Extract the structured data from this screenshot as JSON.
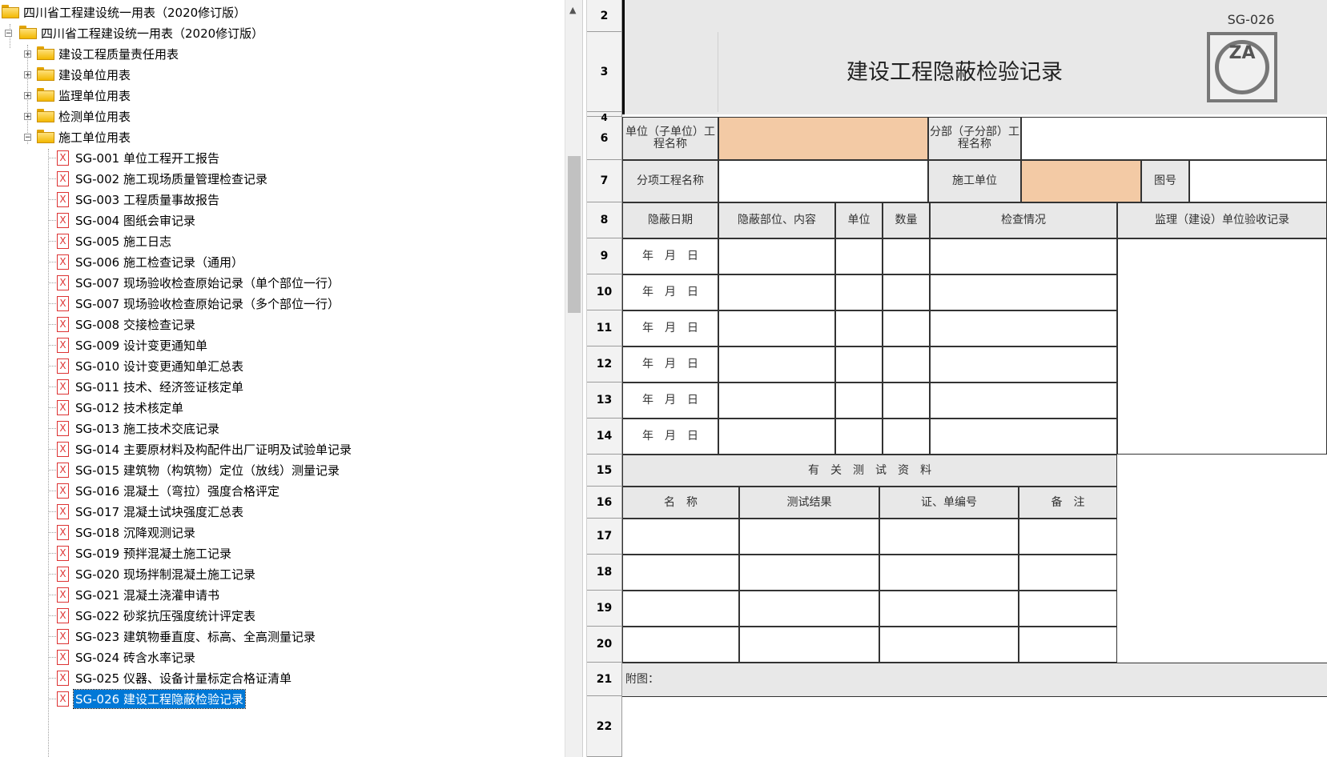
{
  "tree": {
    "root": "四川省工程建设统一用表（2020修订版）",
    "child": "四川省工程建设统一用表（2020修订版）",
    "groups": [
      "建设工程质量责任用表",
      "建设单位用表",
      "监理单位用表",
      "检测单位用表",
      "施工单位用表"
    ],
    "files": [
      "SG-001 单位工程开工报告",
      "SG-002 施工现场质量管理检查记录",
      "SG-003 工程质量事故报告",
      "SG-004 图纸会审记录",
      "SG-005 施工日志",
      "SG-006 施工检查记录（通用）",
      "SG-007 现场验收检查原始记录（单个部位一行）",
      "SG-007 现场验收检查原始记录（多个部位一行）",
      "SG-008 交接检查记录",
      "SG-009 设计变更通知单",
      "SG-010 设计变更通知单汇总表",
      "SG-011 技术、经济签证核定单",
      "SG-012 技术核定单",
      "SG-013 施工技术交底记录",
      "SG-014 主要原材料及构配件出厂证明及试验单记录",
      "SG-015 建筑物（构筑物）定位（放线）测量记录",
      "SG-016 混凝土（弯拉）强度合格评定",
      "SG-017 混凝土试块强度汇总表",
      "SG-018 沉降观测记录",
      "SG-019 预拌混凝土施工记录",
      "SG-020 现场拌制混凝土施工记录",
      "SG-021 混凝土浇灌申请书",
      "SG-022 砂浆抗压强度统计评定表",
      "SG-023 建筑物垂直度、标高、全高测量记录",
      "SG-024 砖含水率记录",
      "SG-025 仪器、设备计量标定合格证清单",
      "SG-026 建设工程隐蔽检验记录"
    ],
    "expand_plus": "+",
    "expand_minus": "−",
    "file_glyph": "X",
    "scroll_up": "▲"
  },
  "sheet": {
    "row_numbers": [
      "2",
      "3",
      "4",
      "6",
      "7",
      "8",
      "9",
      "10",
      "11",
      "12",
      "13",
      "14",
      "15",
      "16",
      "17",
      "18",
      "19",
      "20",
      "21",
      "22"
    ],
    "code": "SG-026",
    "title": "建设工程隐蔽检验记录",
    "logo_text": "ZA",
    "unit_label": "单位（子单位）工程名称",
    "division_label": "分部（子分部）工程名称",
    "subitem_label": "分项工程名称",
    "contractor_label": "施工单位",
    "drawing_label": "图号",
    "headers": [
      "隐蔽日期",
      "隐蔽部位、内容",
      "单位",
      "数量",
      "检查情况",
      "监理（建设）单位验收记录"
    ],
    "date_placeholder": "年　月　日",
    "test_title": "有　关　测　试　资　料",
    "test_headers": [
      "名　称",
      "测试结果",
      "证、单编号",
      "备　注"
    ],
    "attachment_label": "附图："
  }
}
